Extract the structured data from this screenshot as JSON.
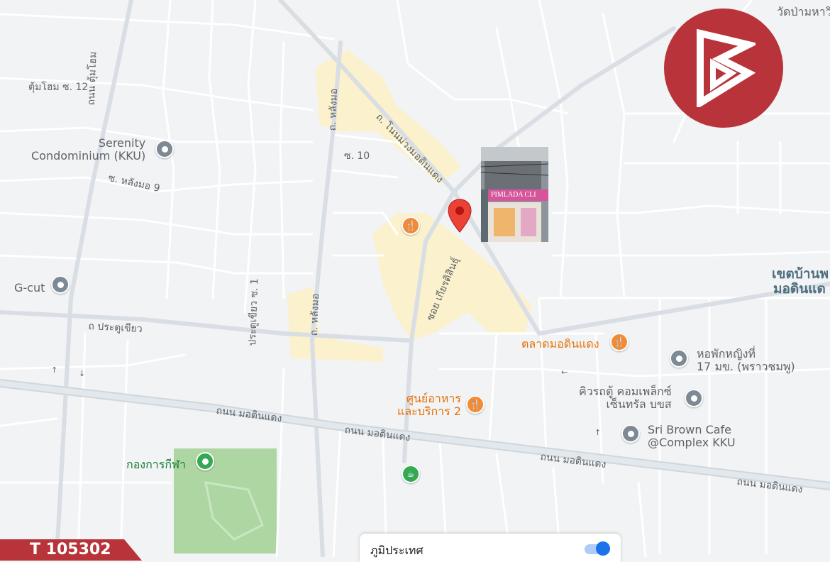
{
  "map": {
    "logo_icon": "brand-b-logo-icon",
    "brand_color": "#b8333a",
    "reference_code": "T 105302",
    "marker_icon": "red-location-pin-icon"
  },
  "streets": {
    "tumhom_12": "ตุ้มโฮม ซ. 12",
    "tumhom_rd": "ถนน ตุ้มโฮม",
    "langmo_rd": "ถ. หลังมอ",
    "langmo_rd_south": "ถ. หลังมอ",
    "nonmuang_rd": "ถ. โนนม่วงมอดินแดง",
    "soi_10": "ซ. 10",
    "langmo_9": "ซ. หลังมอ 9",
    "kiatsin": "ซอย เกียรติสินธุ์",
    "pratu_khiao_1": "ประตูเขียว ซ. 1",
    "pratu_khiao": "ถ ประตูเขียว",
    "modindaeng_1": "ถนน มอดินแดง",
    "modindaeng_2": "ถนน มอดินแดง",
    "modindaeng_3": "ถนน มอดินแดง",
    "modindaeng_4": "ถนน มอดินแดง"
  },
  "places": {
    "wat_pa": "วัดป่ามหาวิ",
    "serenity": "Serenity\nCondominium (KKU)",
    "gcut": "G-cut",
    "area_name_1": "เขตบ้านพ",
    "area_name_2": "มอดินแด",
    "market": "ตลาดมอดินแดง",
    "dorm": "หอพักหญิงที่\n17 มข. (พราวชมพู)",
    "queue": "คิวรถตู้ คอมเพล็กซ์\nเซ็นทรัล บขส",
    "food_center": "ศูนย์อาหาร\nและบริการ 2",
    "sri_brown": "Sri Brown Cafe\n@Complex KKU",
    "sport": "กองการกีฬา"
  },
  "photo": {
    "sign_text": "PIMLADA CLI"
  },
  "layer_toggle": {
    "label": "ภูมิประเทศ",
    "checked": true
  },
  "colors": {
    "road": "#ffffff",
    "road_casing": "#d5dbe0",
    "major_road": "#dfe4e9",
    "background": "#f1f3f4",
    "park": "#aed6a2",
    "highlight": "#fdf1c9"
  }
}
